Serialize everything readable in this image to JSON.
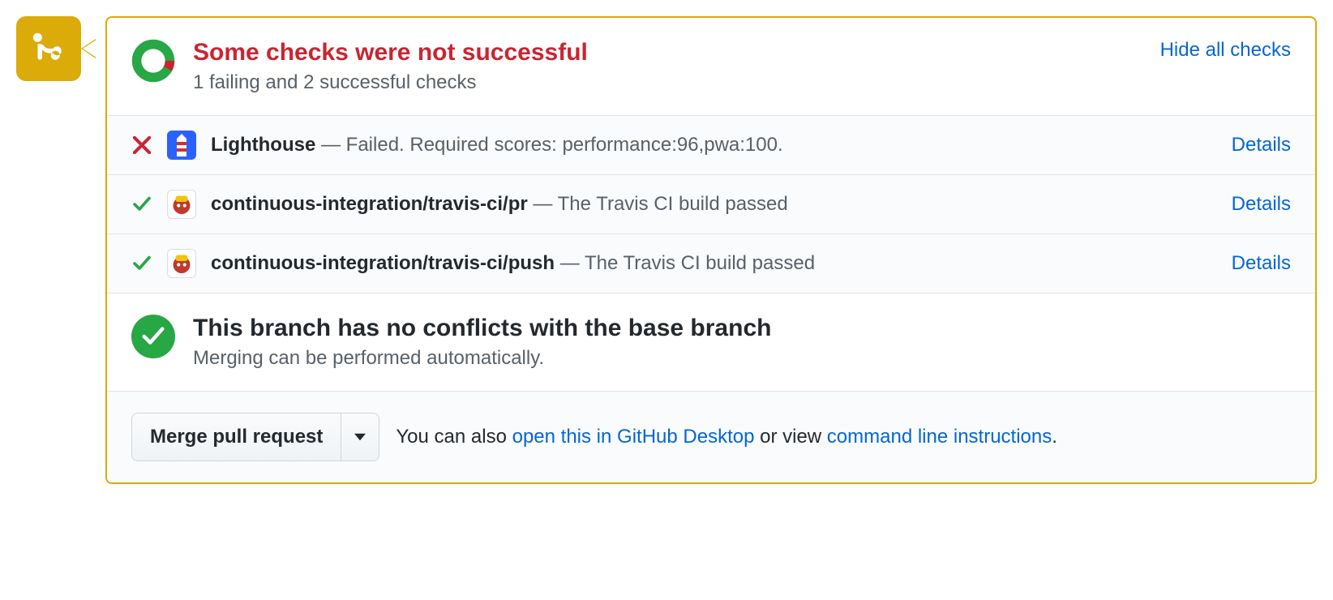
{
  "header": {
    "title": "Some checks were not successful",
    "subtitle": "1 failing and 2 successful checks",
    "hide_link": "Hide all checks"
  },
  "checks": [
    {
      "status": "fail",
      "avatar": "lighthouse",
      "name": "Lighthouse",
      "desc": "Failed. Required scores: performance:96,pwa:100.",
      "details": "Details"
    },
    {
      "status": "pass",
      "avatar": "travis",
      "name": "continuous-integration/travis-ci/pr",
      "desc": "The Travis CI build passed",
      "details": "Details"
    },
    {
      "status": "pass",
      "avatar": "travis",
      "name": "continuous-integration/travis-ci/push",
      "desc": "The Travis CI build passed",
      "details": "Details"
    }
  ],
  "conflict": {
    "title": "This branch has no conflicts with the base branch",
    "subtitle": "Merging can be performed automatically."
  },
  "footer": {
    "merge_button": "Merge pull request",
    "prefix": "You can also ",
    "desktop_link": "open this in GitHub Desktop",
    "middle": " or view ",
    "cli_link": "command line instructions",
    "suffix": "."
  }
}
